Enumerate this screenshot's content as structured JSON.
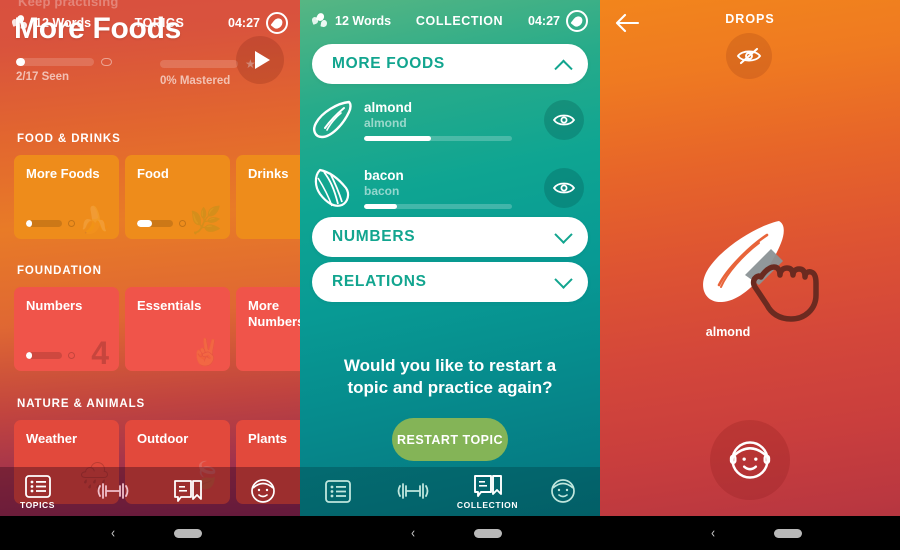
{
  "panel_topics": {
    "faint_top_text": "Keep practising",
    "status": {
      "words": "12 Words",
      "center_label": "TOPICS",
      "time": "04:27"
    },
    "title": "More Foods",
    "stats": [
      {
        "label": "2/17 Seen",
        "progress": 12,
        "icon": "eye-icon"
      },
      {
        "label": "0% Mastered",
        "progress": 0,
        "icon": "star-icon"
      }
    ],
    "play_button": "play-icon",
    "sections": [
      {
        "heading": "FOOD & DRINKS",
        "cards": [
          {
            "name": "More Foods",
            "progress": 18,
            "glyph": "🥜",
            "color": "#ee8c1b"
          },
          {
            "name": "Food",
            "progress": 42,
            "glyph": "🌿",
            "color": "#ee8c1b"
          },
          {
            "name": "Drinks",
            "progress": 0,
            "glyph": "",
            "color": "#ee8c1b"
          }
        ]
      },
      {
        "heading": "FOUNDATION",
        "cards": [
          {
            "name": "Numbers",
            "progress": 16,
            "glyph": "",
            "bignum": "4",
            "color": "#f0544a"
          },
          {
            "name": "Essentials",
            "progress": 0,
            "glyph": "✌",
            "color": "#f0544a"
          },
          {
            "name": "More Numbers",
            "progress": 0,
            "glyph": "",
            "color": "#f0544a"
          }
        ]
      },
      {
        "heading": "NATURE & ANIMALS",
        "cards": [
          {
            "name": "Weather",
            "progress": 0,
            "glyph": "🌧",
            "color": "#e2493c"
          },
          {
            "name": "Outdoor",
            "progress": 0,
            "glyph": "🍃",
            "color": "#e2493c"
          },
          {
            "name": "Plants",
            "progress": 0,
            "glyph": "",
            "color": "#e2493c"
          }
        ]
      }
    ],
    "tabs": [
      {
        "icon": "list-icon",
        "label": "TOPICS",
        "active": true
      },
      {
        "icon": "dumbbell-icon",
        "label": "",
        "active": false
      },
      {
        "icon": "book-bookmark-icon",
        "label": "",
        "active": false
      },
      {
        "icon": "face-icon",
        "label": "",
        "active": false
      }
    ]
  },
  "panel_collection": {
    "status": {
      "words": "12 Words",
      "center_label": "COLLECTION",
      "time": "04:27"
    },
    "accordions": [
      {
        "title": "MORE FOODS",
        "expanded": true
      },
      {
        "title": "NUMBERS",
        "expanded": false
      },
      {
        "title": "RELATIONS",
        "expanded": false
      }
    ],
    "words": [
      {
        "term": "almond",
        "translation": "almond",
        "progress": 45,
        "icon": "almond-icon",
        "action": "eye-icon"
      },
      {
        "term": "bacon",
        "translation": "bacon",
        "progress": 22,
        "icon": "bacon-icon",
        "action": "eye-icon"
      }
    ],
    "prompt": "Would you like to restart a topic and practice again?",
    "restart_label": "RESTART TOPIC",
    "restart_color": "#84b457",
    "tabs": [
      {
        "icon": "list-icon",
        "label": "",
        "active": false
      },
      {
        "icon": "dumbbell-icon",
        "label": "",
        "active": false
      },
      {
        "icon": "book-bookmark-icon",
        "label": "COLLECTION",
        "active": true
      },
      {
        "icon": "face-icon",
        "label": "",
        "active": false
      }
    ]
  },
  "panel_drops": {
    "back_icon": "arrow-left-icon",
    "title": "DROPS",
    "eye_off_icon": "eye-off-icon",
    "word_label": "almond",
    "word_icon": "almond-icon",
    "cursor_icon": "pointing-hand-icon",
    "avatar_icon": "face-icon"
  },
  "android_nav": {
    "back": "‹",
    "home": "home-pill"
  }
}
